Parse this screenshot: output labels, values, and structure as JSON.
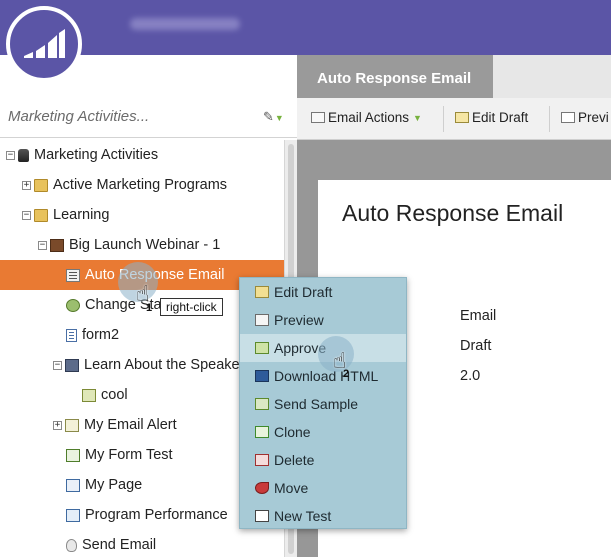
{
  "colors": {
    "topbar": "#5b55a6",
    "selection": "#e97a33",
    "menu_bg": "#a7cad6",
    "menu_hover": "#c8dfe6",
    "accent_green": "#77b23e"
  },
  "header": {
    "logo_icon": "marketo-logo-icon"
  },
  "left_panel": {
    "title": "Marketing Activities...",
    "pin_icon": "pin-icon",
    "tree": [
      {
        "label": "Marketing Activities",
        "icon": "database-icon",
        "expander": "−"
      },
      {
        "label": "Active Marketing Programs",
        "icon": "folder-icon",
        "expander": "+"
      },
      {
        "label": "Learning",
        "icon": "folder-icon",
        "expander": "−"
      },
      {
        "label": "Big Launch Webinar - 1",
        "icon": "program-icon",
        "expander": "−"
      },
      {
        "label": "Auto Response Email",
        "icon": "email-icon",
        "expander": ""
      },
      {
        "label": "Change Status",
        "icon": "smart-campaign-icon",
        "expander": ""
      },
      {
        "label": "form2",
        "icon": "form-icon",
        "expander": ""
      },
      {
        "label": "Learn About the Speaker",
        "icon": "event-icon",
        "expander": "−"
      },
      {
        "label": "cool",
        "icon": "smart-campaign-icon",
        "expander": ""
      },
      {
        "label": "My Email Alert",
        "icon": "email-alert-icon",
        "expander": "+"
      },
      {
        "label": "My Form Test",
        "icon": "form-test-icon",
        "expander": ""
      },
      {
        "label": "My Page",
        "icon": "landing-page-icon",
        "expander": ""
      },
      {
        "label": "Program Performance",
        "icon": "report-icon",
        "expander": ""
      },
      {
        "label": "Send Email",
        "icon": "lightbulb-icon",
        "expander": ""
      }
    ]
  },
  "tab": {
    "label": "Auto Response Email"
  },
  "toolbar": {
    "email_actions": "Email Actions",
    "edit_draft": "Edit Draft",
    "preview": "Previ"
  },
  "detail": {
    "title": "Auto Response Email",
    "type_value": "Email",
    "status_value": "Draft",
    "version_value": "2.0"
  },
  "context_menu": {
    "items": [
      {
        "label": "Edit Draft",
        "icon": "edit-icon"
      },
      {
        "label": "Preview",
        "icon": "preview-icon"
      },
      {
        "label": "Approve",
        "icon": "approve-icon"
      },
      {
        "label": "Download HTML",
        "icon": "download-icon"
      },
      {
        "label": "Send Sample",
        "icon": "send-sample-icon"
      },
      {
        "label": "Clone",
        "icon": "clone-icon"
      },
      {
        "label": "Delete",
        "icon": "delete-icon"
      },
      {
        "label": "Move",
        "icon": "move-icon"
      },
      {
        "label": "New Test",
        "icon": "new-test-icon"
      }
    ]
  },
  "annotations": {
    "step1": "1",
    "step1_label": "right-click",
    "step2": "2"
  }
}
